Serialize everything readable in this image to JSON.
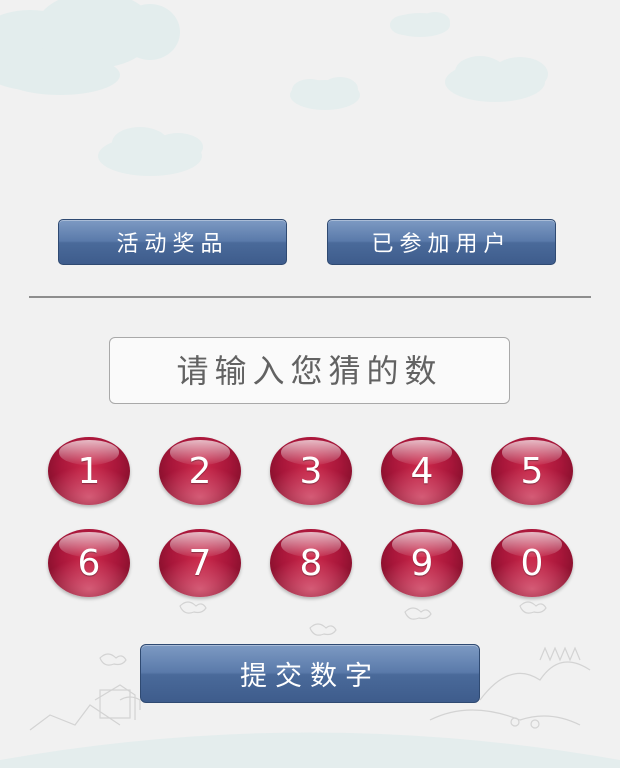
{
  "top_buttons": {
    "prizes_label": "活动奖品",
    "participants_label": "已参加用户"
  },
  "guess_input": {
    "value": "",
    "placeholder": "请输入您猜的数"
  },
  "keypad": {
    "keys": [
      "1",
      "2",
      "3",
      "4",
      "5",
      "6",
      "7",
      "8",
      "9",
      "0"
    ],
    "key_color": "#b01a40"
  },
  "submit_label": "提交数字",
  "colors": {
    "background": "#f1f1f1",
    "button_blue": "#4f6fa0",
    "cloud": "#e2ecec"
  }
}
